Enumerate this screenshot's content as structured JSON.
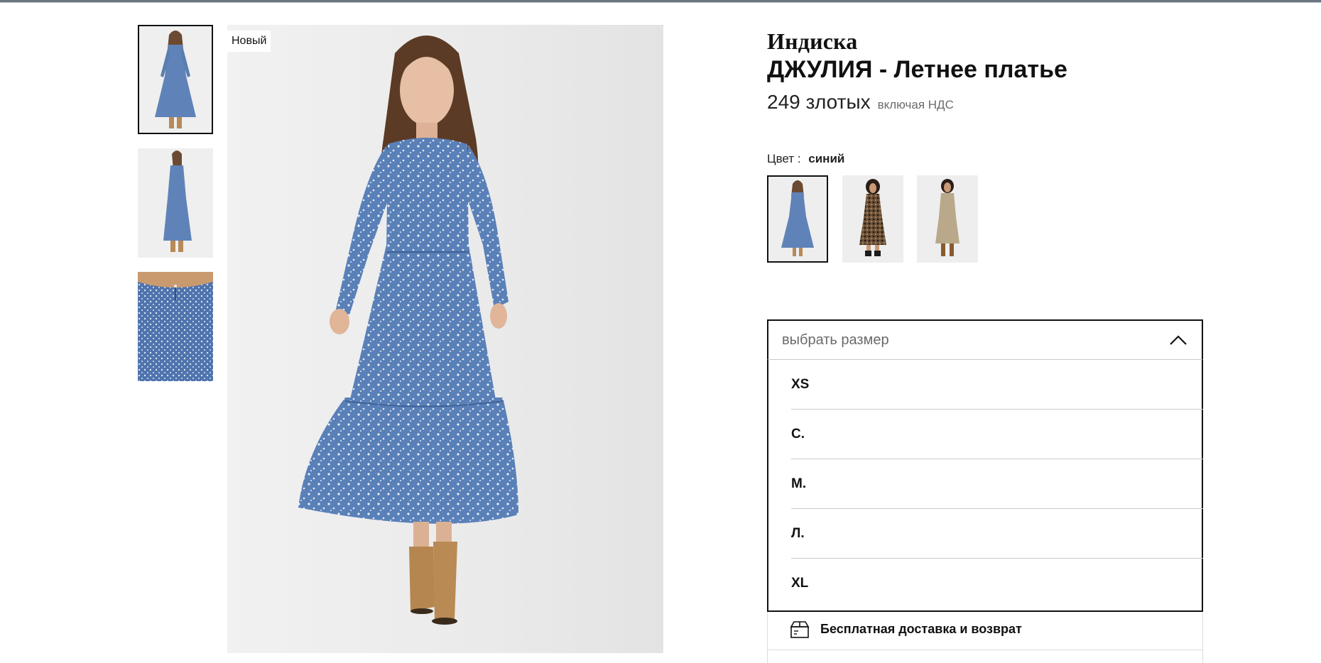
{
  "badge": "Новый",
  "product": {
    "brand": "Индиска",
    "title": "ДЖУЛИЯ - Летнее платье",
    "price": "249 злотых",
    "vat_note": "включая НДС"
  },
  "color": {
    "label": "Цвет :",
    "value": "синий",
    "swatches": [
      {
        "name": "blue-dots",
        "selected": true
      },
      {
        "name": "leopard",
        "selected": false
      },
      {
        "name": "beige-floral",
        "selected": false
      }
    ]
  },
  "size_select": {
    "placeholder": "выбрать размер",
    "expanded": true,
    "options": [
      "XS",
      "С.",
      "М.",
      "Л.",
      "XL"
    ]
  },
  "delivery": {
    "text": "Бесплатная доставка и возврат",
    "icon": "delivery-box-icon"
  },
  "thumbnails": [
    "front-view",
    "side-view",
    "back-detail"
  ],
  "colors": {
    "dress_blue": "#5f83b8",
    "border_dark": "#111111",
    "divider": "#c9c9c9"
  }
}
